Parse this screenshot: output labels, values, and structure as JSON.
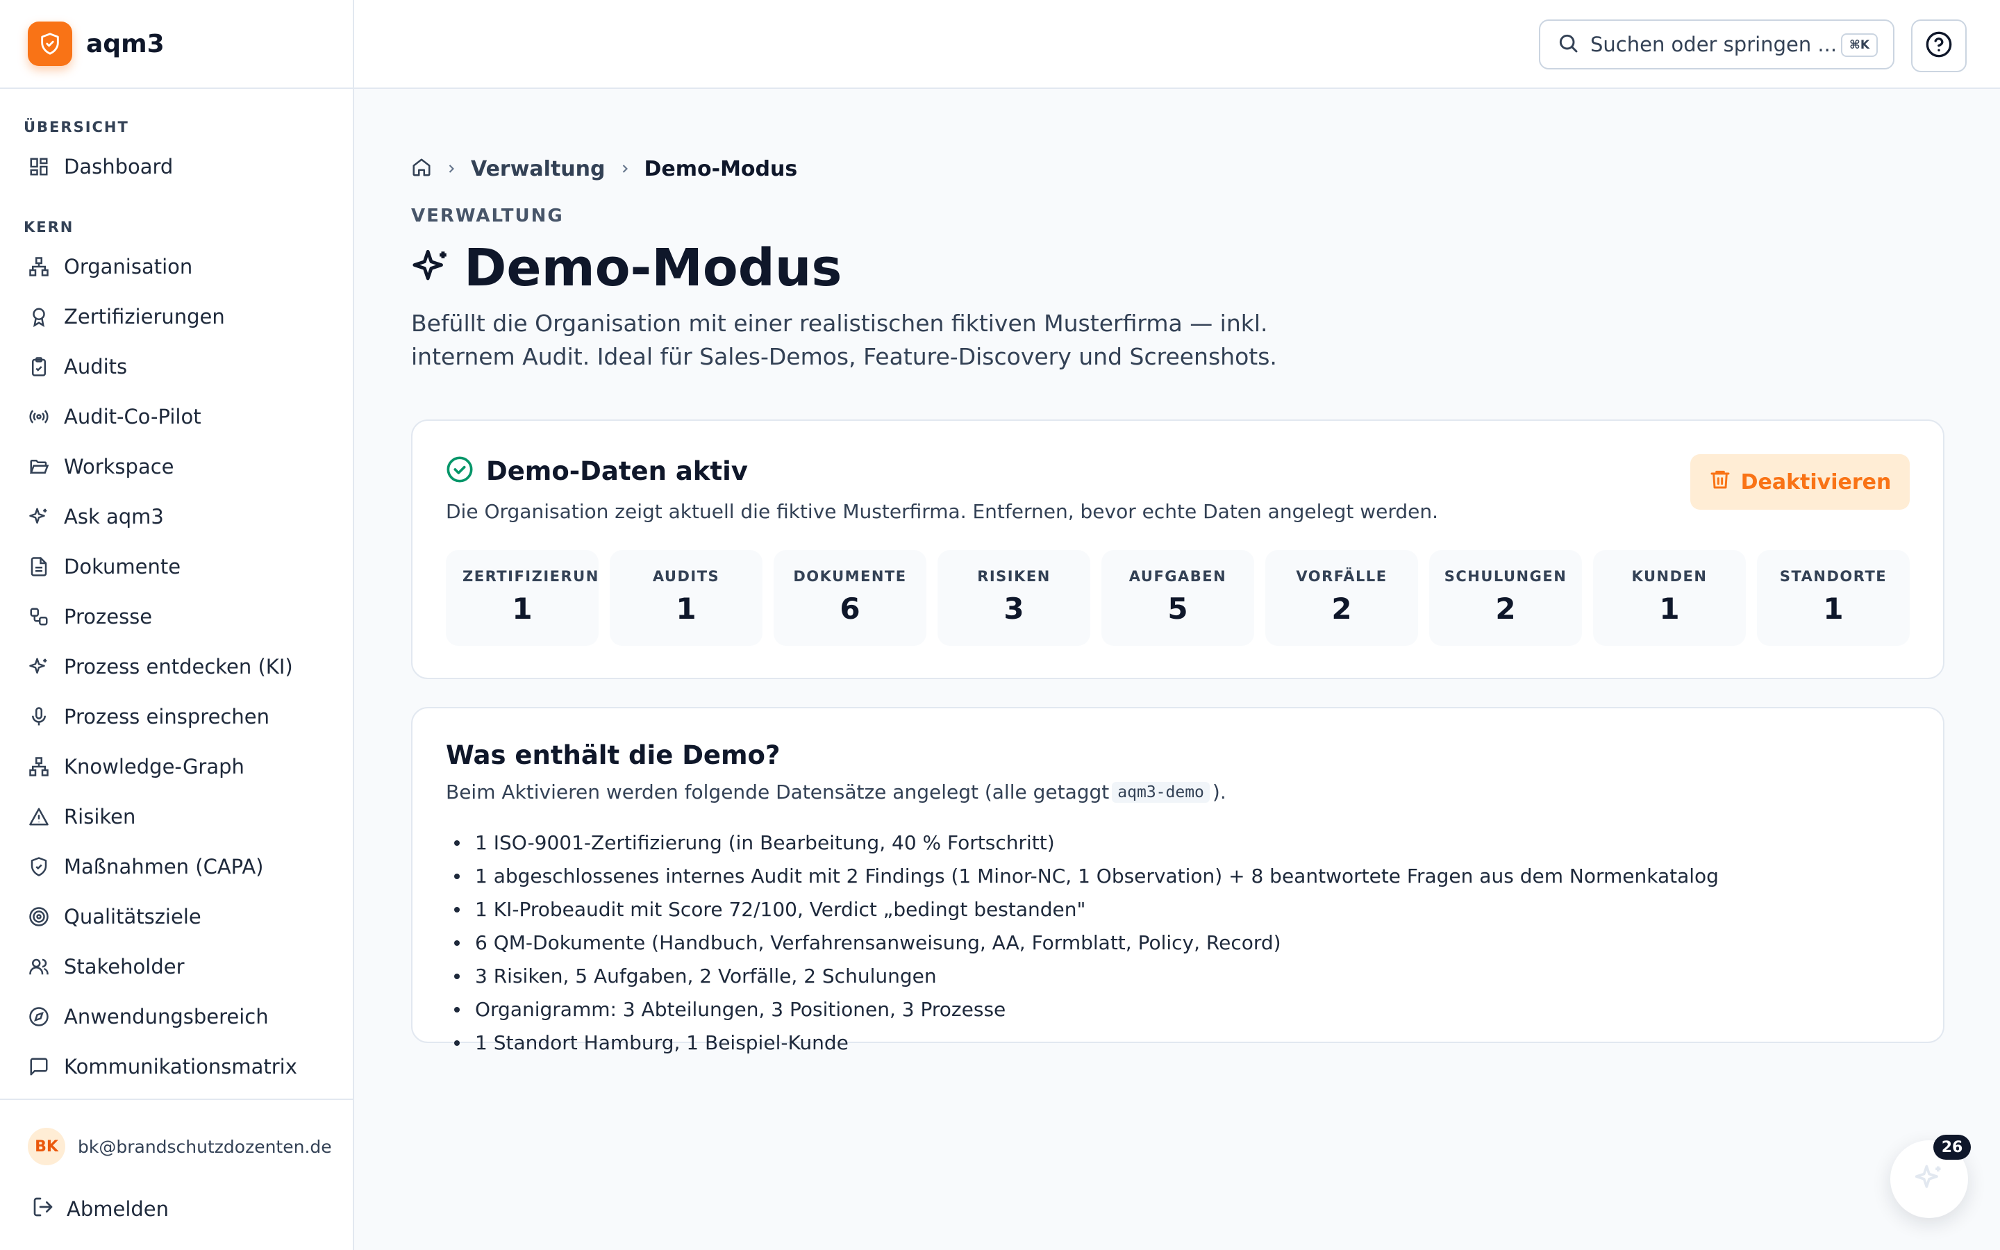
{
  "app": {
    "name": "aqm3"
  },
  "sidebar": {
    "sections": [
      {
        "title": "ÜBERSICHT",
        "items": [
          {
            "label": "Dashboard",
            "icon": "dashboard-icon"
          }
        ]
      },
      {
        "title": "KERN",
        "items": [
          {
            "label": "Organisation",
            "icon": "org-chart-icon"
          },
          {
            "label": "Zertifizierungen",
            "icon": "award-icon"
          },
          {
            "label": "Audits",
            "icon": "clipboard-check-icon"
          },
          {
            "label": "Audit-Co-Pilot",
            "icon": "radio-icon"
          },
          {
            "label": "Workspace",
            "icon": "folder-open-icon"
          },
          {
            "label": "Ask aqm3",
            "icon": "sparkles-icon"
          },
          {
            "label": "Dokumente",
            "icon": "document-icon"
          },
          {
            "label": "Prozesse",
            "icon": "workflow-icon"
          },
          {
            "label": "Prozess entdecken (KI)",
            "icon": "sparkles-icon"
          },
          {
            "label": "Prozess einsprechen",
            "icon": "microphone-icon"
          },
          {
            "label": "Knowledge-Graph",
            "icon": "network-icon"
          },
          {
            "label": "Risiken",
            "icon": "warning-triangle-icon"
          },
          {
            "label": "Maßnahmen (CAPA)",
            "icon": "shield-check-icon"
          },
          {
            "label": "Qualitätsziele",
            "icon": "target-icon"
          },
          {
            "label": "Stakeholder",
            "icon": "users-icon"
          },
          {
            "label": "Anwendungsbereich",
            "icon": "compass-icon"
          },
          {
            "label": "Kommunikationsmatrix",
            "icon": "message-square-icon"
          }
        ]
      }
    ],
    "user": {
      "initials": "BK",
      "email": "bk@brandschutzdozenten.de"
    },
    "logout_label": "Abmelden"
  },
  "topbar": {
    "search_placeholder": "Suchen oder springen ...",
    "search_shortcut": "⌘K"
  },
  "breadcrumb": {
    "section": "Verwaltung",
    "current": "Demo-Modus"
  },
  "page": {
    "eyebrow": "VERWALTUNG",
    "title": "Demo-Modus",
    "description_line1": "Befüllt die Organisation mit einer realistischen fiktiven Musterfirma — inkl.",
    "description_line2": "internem Audit. Ideal für Sales-Demos, Feature-Discovery und Screenshots."
  },
  "status_card": {
    "title": "Demo-Daten aktiv",
    "subtitle": "Die Organisation zeigt aktuell die fiktive Musterfirma. Entfernen, bevor echte Daten angelegt werden.",
    "deactivate_label": "Deaktivieren",
    "stats": [
      {
        "label": "ZERTIFIZIERUNGEN",
        "value": "1"
      },
      {
        "label": "AUDITS",
        "value": "1"
      },
      {
        "label": "DOKUMENTE",
        "value": "6"
      },
      {
        "label": "RISIKEN",
        "value": "3"
      },
      {
        "label": "AUFGABEN",
        "value": "5"
      },
      {
        "label": "VORFÄLLE",
        "value": "2"
      },
      {
        "label": "SCHULUNGEN",
        "value": "2"
      },
      {
        "label": "KUNDEN",
        "value": "1"
      },
      {
        "label": "STANDORTE",
        "value": "1"
      }
    ]
  },
  "info_card": {
    "title": "Was enthält die Demo?",
    "subtitle_before": "Beim Aktivieren werden folgende Datensätze angelegt (alle getaggt",
    "tag": "aqm3-demo",
    "subtitle_after": ").",
    "items": [
      "1 ISO-9001-Zertifizierung (in Bearbeitung, 40 % Fortschritt)",
      "1 abgeschlossenes internes Audit mit 2 Findings (1 Minor-NC, 1 Observation) + 8 beantwortete Fragen aus dem Normenkatalog",
      "1 KI-Probeaudit mit Score 72/100, Verdict „bedingt bestanden\"",
      "6 QM-Dokumente (Handbuch, Verfahrensanweisung, AA, Formblatt, Policy, Record)",
      "3 Risiken, 5 Aufgaben, 2 Vorfälle, 2 Schulungen",
      "Organigramm: 3 Abteilungen, 3 Positionen, 3 Prozesse",
      "1 Standort Hamburg, 1 Beispiel-Kunde"
    ]
  },
  "fab": {
    "badge": "26"
  },
  "colors": {
    "accent": "#f97316",
    "accent_soft": "#ffedd5",
    "success": "#059669",
    "text": "#0f172a"
  }
}
